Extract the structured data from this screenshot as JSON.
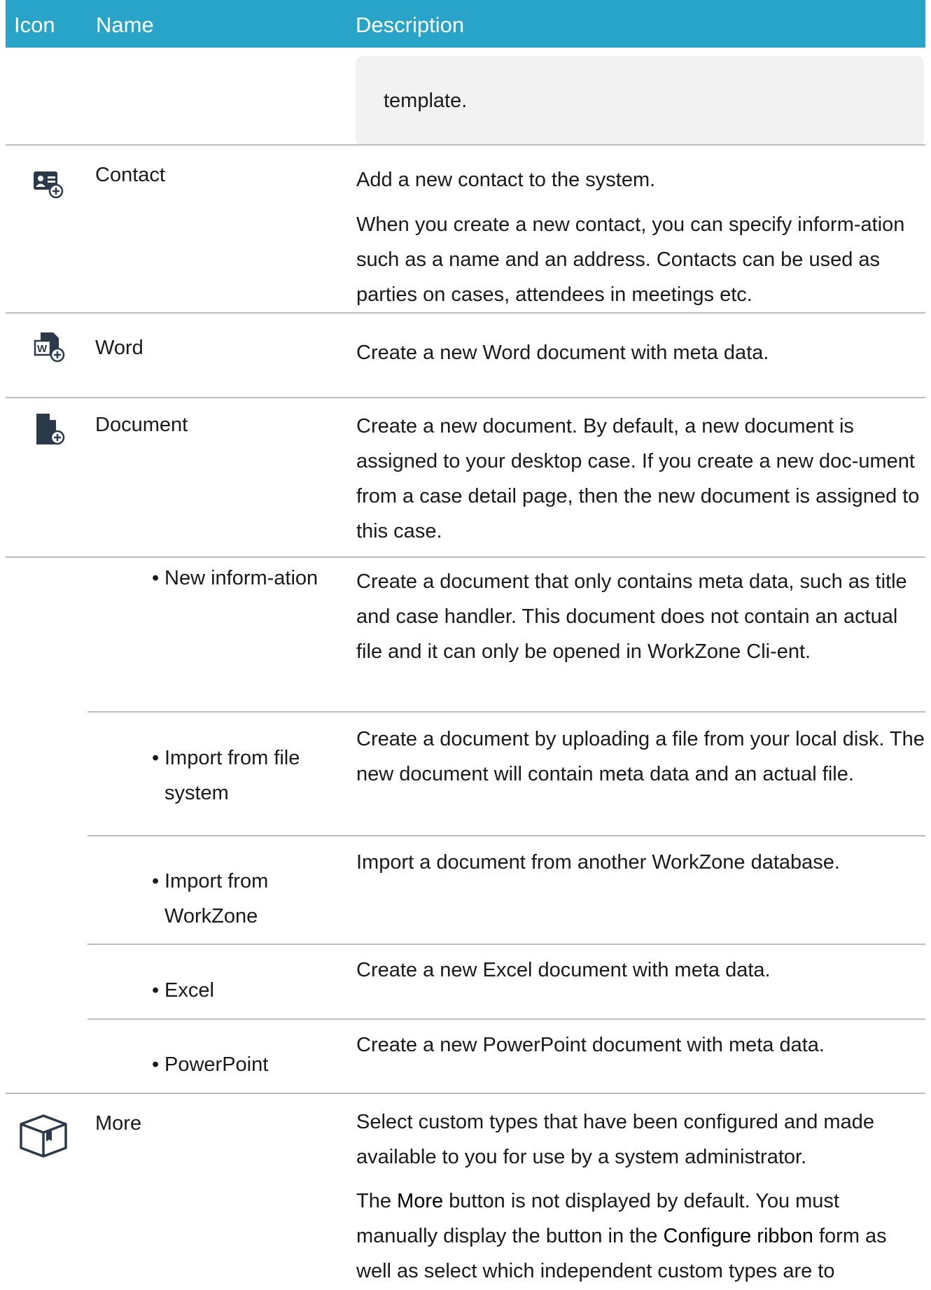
{
  "header": {
    "icon": "Icon",
    "name": "Name",
    "description": "Description"
  },
  "note": {
    "text": "template."
  },
  "rows": {
    "contact": {
      "icon": "contact-card-add-icon",
      "name": "Contact",
      "desc1": "Add a new contact to the system.",
      "desc2": "When you create a new contact, you can specify inform-ation such as a name and an address. Contacts can be used as parties on cases, attendees in meetings etc."
    },
    "word": {
      "icon": "word-document-add-icon",
      "name": "Word",
      "desc": "Create a new Word document with meta data."
    },
    "document": {
      "icon": "document-add-icon",
      "name": "Document",
      "desc": "Create a new document. By default, a new document is assigned to your desktop case. If you create a new doc-ument from a case detail page, then the new document is assigned to this case."
    },
    "sub": [
      {
        "bullet": "•",
        "name": "New inform-ation",
        "desc": "Create a document that only contains meta data, such as title and case handler. This document does not contain an actual file and it can only be opened in WorkZone Cli-ent."
      },
      {
        "bullet": "•",
        "name": "Import from file system",
        "desc": "Create a document by uploading a file from your local disk. The new document will contain meta data and an actual file."
      },
      {
        "bullet": "•",
        "name": "Import from WorkZone",
        "desc": "Import a document from another WorkZone database."
      },
      {
        "bullet": "•",
        "name": "Excel",
        "desc": "Create a new Excel document with meta data."
      },
      {
        "bullet": "•",
        "name": "PowerPoint",
        "desc": "Create a new PowerPoint document with meta data."
      }
    ],
    "more": {
      "icon": "package-box-icon",
      "name": "More",
      "desc1": "Select custom types that have been configured and made available to you for use by a system administrator.",
      "desc2_pre": "The ",
      "desc2_more": "More",
      "desc2_mid": " button is not displayed by default. You must manually display the button in the ",
      "desc2_ribbon": "Configure ribbon",
      "desc2_post": " form as well as select which independent custom types are to"
    }
  }
}
